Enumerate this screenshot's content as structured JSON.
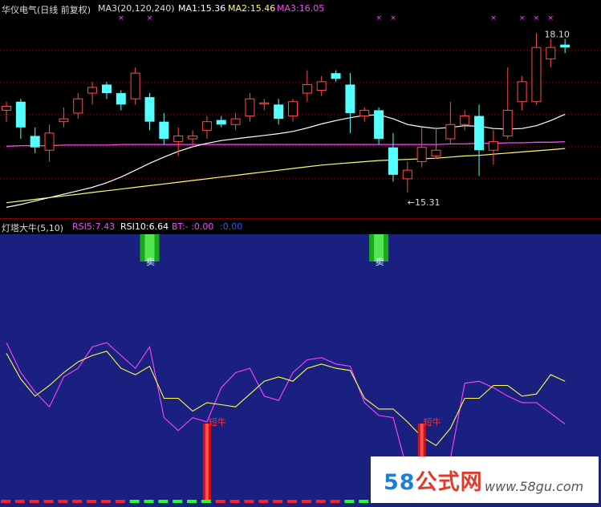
{
  "upper_header": {
    "name": "华仪电气(日线 前复权)",
    "ma3_params": "MA3(20,120,240)",
    "ma1": "MA1:15.36",
    "ma2": "MA2:15.46",
    "ma3": "MA3:16.05"
  },
  "lower_header": {
    "name": "灯塔大牛(5,10)",
    "rsi5": "RSI5:7.43",
    "rsi10": "RSI10:6.64",
    "bt": "BT:- :0.00",
    "extra": ":0.00"
  },
  "annotations": {
    "high_price": "18.10",
    "low_price": "←15.31",
    "sell_label": "卖",
    "bull_label": "短牛"
  },
  "watermark": {
    "logo_a": "58",
    "logo_b": "公式网",
    "url": "www.58gu.com"
  },
  "colors": {
    "up": "#ff4b4b",
    "down": "#54ffff",
    "ma1": "#ffffff",
    "ma2": "#ff44ff",
    "ma3": "#ffff66",
    "rsi5": "#ff44ff",
    "rsi10": "#ffff44",
    "panel_bg": "#1a2080"
  },
  "chart_data": [
    {
      "type": "candlestick",
      "title": "华仪电气(日线 前复权)",
      "ylim": [
        15.0,
        18.4
      ],
      "candles": [
        {
          "o": 16.75,
          "h": 16.9,
          "l": 16.55,
          "c": 16.82
        },
        {
          "o": 16.9,
          "h": 16.95,
          "l": 16.25,
          "c": 16.45
        },
        {
          "o": 16.3,
          "h": 16.45,
          "l": 16.0,
          "c": 16.1
        },
        {
          "o": 16.05,
          "h": 16.5,
          "l": 15.85,
          "c": 16.35
        },
        {
          "o": 16.55,
          "h": 16.8,
          "l": 16.45,
          "c": 16.6
        },
        {
          "o": 16.7,
          "h": 17.05,
          "l": 16.6,
          "c": 16.95
        },
        {
          "o": 17.05,
          "h": 17.25,
          "l": 16.85,
          "c": 17.15
        },
        {
          "o": 17.2,
          "h": 17.25,
          "l": 16.95,
          "c": 17.05
        },
        {
          "o": 17.05,
          "h": 17.1,
          "l": 16.75,
          "c": 16.85
        },
        {
          "o": 16.95,
          "h": 17.5,
          "l": 16.85,
          "c": 17.4
        },
        {
          "o": 16.98,
          "h": 17.05,
          "l": 16.4,
          "c": 16.55
        },
        {
          "o": 16.55,
          "h": 16.7,
          "l": 16.15,
          "c": 16.25
        },
        {
          "o": 16.2,
          "h": 16.45,
          "l": 15.95,
          "c": 16.3
        },
        {
          "o": 16.25,
          "h": 16.4,
          "l": 16.1,
          "c": 16.3
        },
        {
          "o": 16.4,
          "h": 16.65,
          "l": 16.25,
          "c": 16.55
        },
        {
          "o": 16.58,
          "h": 16.65,
          "l": 16.45,
          "c": 16.5
        },
        {
          "o": 16.5,
          "h": 16.7,
          "l": 16.4,
          "c": 16.6
        },
        {
          "o": 16.65,
          "h": 17.05,
          "l": 16.55,
          "c": 16.95
        },
        {
          "o": 16.88,
          "h": 16.95,
          "l": 16.75,
          "c": 16.88
        },
        {
          "o": 16.85,
          "h": 16.95,
          "l": 16.5,
          "c": 16.6
        },
        {
          "o": 16.65,
          "h": 16.95,
          "l": 16.55,
          "c": 16.9
        },
        {
          "o": 17.05,
          "h": 17.45,
          "l": 16.9,
          "c": 17.2
        },
        {
          "o": 17.1,
          "h": 17.35,
          "l": 17.0,
          "c": 17.25
        },
        {
          "o": 17.4,
          "h": 17.45,
          "l": 17.25,
          "c": 17.3
        },
        {
          "o": 17.2,
          "h": 17.4,
          "l": 16.35,
          "c": 16.7
        },
        {
          "o": 16.65,
          "h": 16.8,
          "l": 16.55,
          "c": 16.75
        },
        {
          "o": 16.75,
          "h": 16.8,
          "l": 16.15,
          "c": 16.25
        },
        {
          "o": 16.1,
          "h": 16.35,
          "l": 15.5,
          "c": 15.62
        },
        {
          "o": 15.55,
          "h": 15.85,
          "l": 15.31,
          "c": 15.7
        },
        {
          "o": 15.85,
          "h": 16.45,
          "l": 15.75,
          "c": 16.1
        },
        {
          "o": 15.95,
          "h": 16.45,
          "l": 15.9,
          "c": 16.05
        },
        {
          "o": 16.25,
          "h": 16.9,
          "l": 16.15,
          "c": 16.5
        },
        {
          "o": 16.5,
          "h": 16.75,
          "l": 16.4,
          "c": 16.65
        },
        {
          "o": 16.65,
          "h": 16.85,
          "l": 15.6,
          "c": 16.05
        },
        {
          "o": 16.05,
          "h": 16.4,
          "l": 15.8,
          "c": 16.2
        },
        {
          "o": 16.3,
          "h": 17.5,
          "l": 16.25,
          "c": 16.75
        },
        {
          "o": 16.9,
          "h": 17.35,
          "l": 16.75,
          "c": 17.25
        },
        {
          "o": 16.9,
          "h": 18.1,
          "l": 16.85,
          "c": 17.85
        },
        {
          "o": 17.65,
          "h": 18.0,
          "l": 17.5,
          "c": 17.85
        },
        {
          "o": 17.9,
          "h": 18.0,
          "l": 17.75,
          "c": 17.85
        }
      ],
      "ma1": [
        15.05,
        15.1,
        15.16,
        15.22,
        15.28,
        15.34,
        15.4,
        15.48,
        15.58,
        15.7,
        15.82,
        15.93,
        16.03,
        16.11,
        16.17,
        16.22,
        16.25,
        16.28,
        16.31,
        16.34,
        16.38,
        16.44,
        16.51,
        16.57,
        16.62,
        16.66,
        16.67,
        16.6,
        16.5,
        16.46,
        16.43,
        16.45,
        16.48,
        16.47,
        16.43,
        16.42,
        16.43,
        16.48,
        16.57,
        16.68
      ],
      "ma2": [
        16.12,
        16.13,
        16.13,
        16.13,
        16.14,
        16.14,
        16.14,
        16.14,
        16.15,
        16.15,
        16.15,
        16.15,
        16.15,
        16.15,
        16.15,
        16.15,
        16.15,
        16.15,
        16.15,
        16.15,
        16.15,
        16.15,
        16.15,
        16.15,
        16.15,
        16.15,
        16.15,
        16.15,
        16.15,
        16.15,
        16.15,
        16.16,
        16.16,
        16.17,
        16.17,
        16.18,
        16.18,
        16.19,
        16.19,
        16.2
      ],
      "ma3": [
        15.13,
        15.16,
        15.19,
        15.22,
        15.25,
        15.28,
        15.31,
        15.34,
        15.37,
        15.4,
        15.43,
        15.46,
        15.49,
        15.52,
        15.55,
        15.58,
        15.61,
        15.64,
        15.67,
        15.7,
        15.73,
        15.76,
        15.79,
        15.81,
        15.83,
        15.85,
        15.87,
        15.88,
        15.89,
        15.9,
        15.91,
        15.93,
        15.95,
        15.96,
        15.98,
        16.0,
        16.02,
        16.04,
        16.06,
        16.08
      ],
      "markers_x": [
        8,
        10,
        26,
        27,
        34,
        36,
        37,
        38
      ],
      "high_annotation_index": 37,
      "low_annotation_index": 28
    },
    {
      "type": "line",
      "title": "灯塔大牛(5,10)",
      "ylim": [
        0,
        100
      ],
      "series": [
        {
          "name": "RSI5",
          "values": [
            70,
            56,
            47,
            40,
            54,
            58,
            68,
            70,
            64,
            58,
            68,
            35,
            29,
            35,
            33,
            49,
            56,
            58,
            45,
            43,
            56,
            62,
            63,
            60,
            59,
            42,
            36,
            35,
            10,
            4,
            4,
            16,
            51,
            52,
            49,
            45,
            42,
            42,
            37,
            32
          ]
        },
        {
          "name": "RSI10",
          "values": [
            65,
            53,
            45,
            50,
            56,
            61,
            64,
            66,
            58,
            55,
            59,
            44,
            44,
            38,
            42,
            41,
            40,
            46,
            52,
            54,
            52,
            58,
            60,
            58,
            57,
            44,
            39,
            39,
            33,
            26,
            22,
            30,
            44,
            44,
            50,
            50,
            45,
            46,
            55,
            52
          ]
        }
      ],
      "sell_signal_index": [
        10,
        26
      ],
      "bull_signal_index": [
        14,
        29
      ]
    }
  ]
}
